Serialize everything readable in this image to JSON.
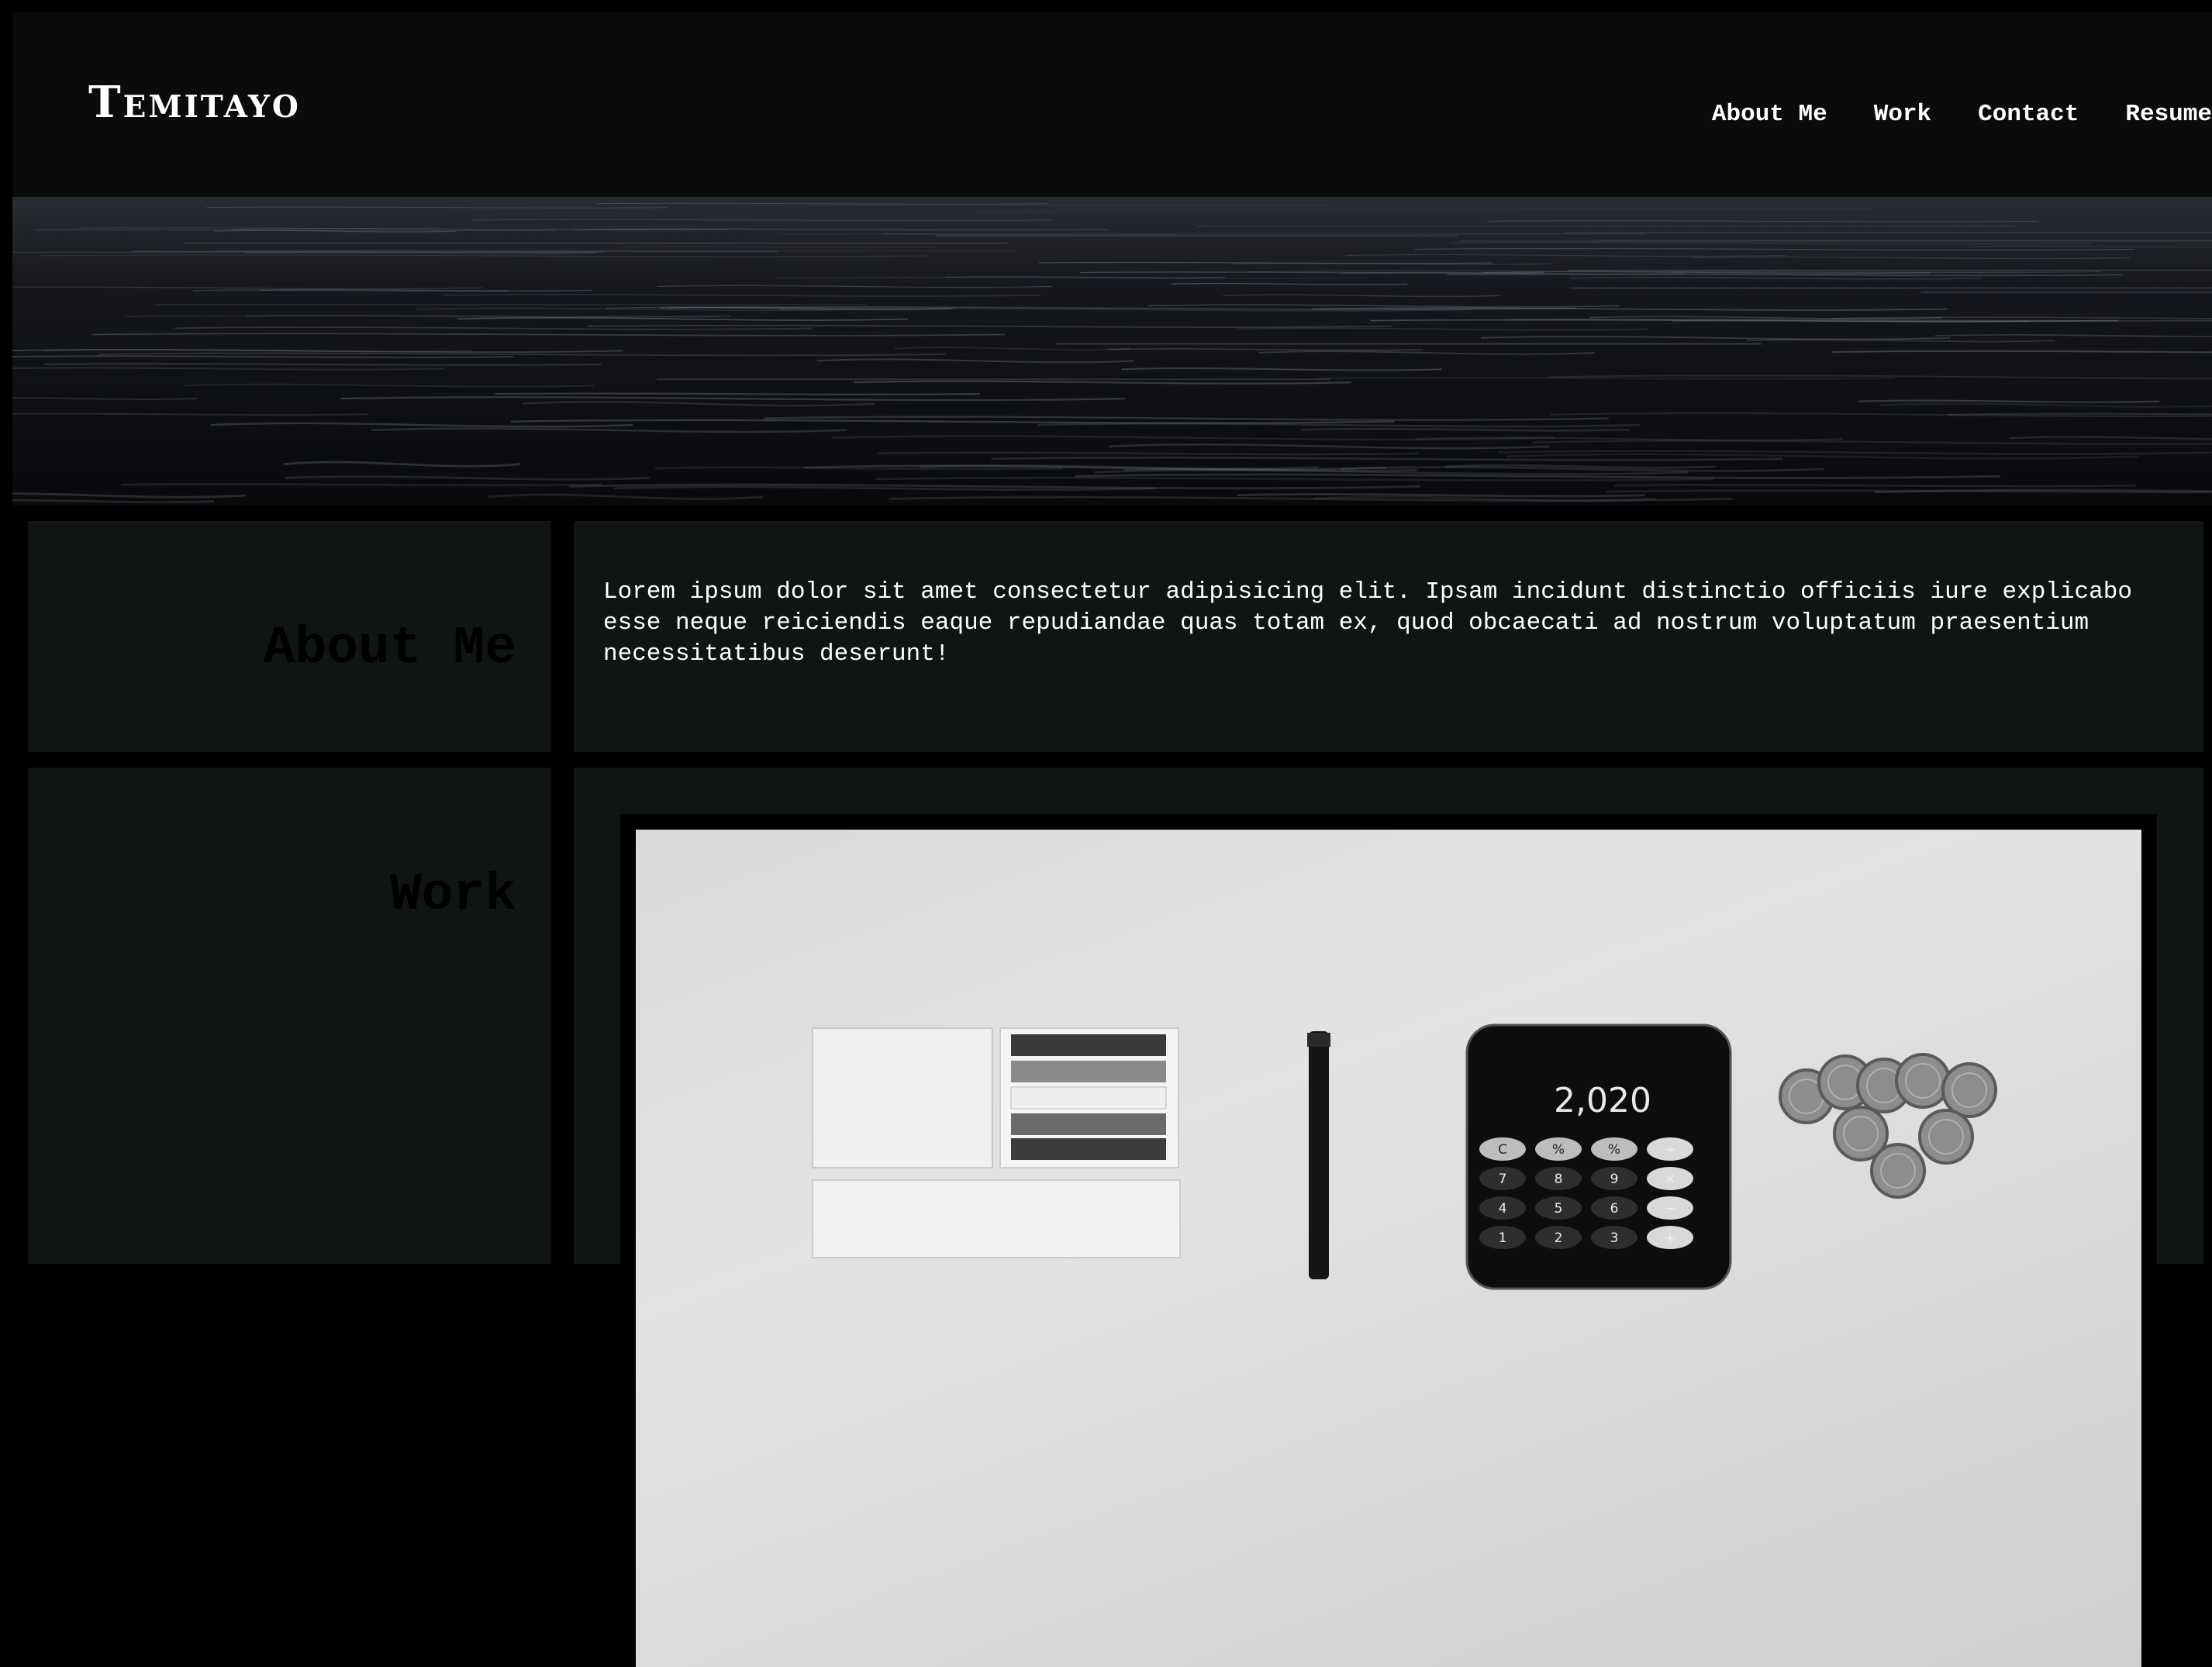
{
  "header": {
    "brand": "Temitayo",
    "nav": [
      "About Me",
      "Work",
      "Contact",
      "Resume"
    ]
  },
  "about": {
    "title": "About Me",
    "text": "Lorem ipsum dolor sit amet consectetur adipisicing elit. Ipsam incidunt distinctio officiis iure explicabo esse neque reiciendis eaque repudiandae quas totam ex, quod obcaecati ad nostrum voluptatum praesentium necessitatibus deserunt!"
  },
  "work": {
    "title": "Work",
    "calculator_display": "2,020",
    "calculator_keys": [
      "C",
      "%",
      "%",
      "÷",
      "7",
      "8",
      "9",
      "×",
      "4",
      "5",
      "6",
      "−",
      "1",
      "2",
      "3",
      "+"
    ]
  },
  "colors": {
    "background": "#000000",
    "header": "#0a0c0c",
    "panel": "#101513",
    "text": "#ffffff",
    "section_title": "#000000"
  }
}
